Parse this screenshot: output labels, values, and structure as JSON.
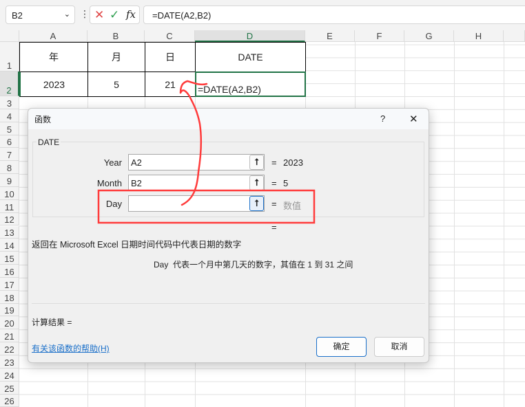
{
  "namebox": {
    "value": "B2"
  },
  "formula_bar": {
    "cancel_icon": "x-icon",
    "enter_icon": "check-icon",
    "fx": "fx",
    "formula": "=DATE(A2,B2)"
  },
  "columns": [
    "A",
    "B",
    "C",
    "D",
    "E",
    "F",
    "G",
    "H"
  ],
  "rows": [
    "1",
    "2",
    "3",
    "4",
    "5",
    "6",
    "7",
    "8",
    "9",
    "10",
    "11",
    "12",
    "13",
    "14",
    "15",
    "16",
    "17",
    "18",
    "19",
    "20",
    "21",
    "22",
    "23",
    "24",
    "25",
    "26"
  ],
  "cells": {
    "A1": "年",
    "B1": "月",
    "C1": "日",
    "D1": "DATE",
    "A2": "2023",
    "B2": "5",
    "C2": "21",
    "D2": "=DATE(A2,B2)"
  },
  "dialog": {
    "title": "函数",
    "help": "?",
    "close": "✕",
    "function_name": "DATE",
    "args": [
      {
        "label": "Year",
        "value": "A2",
        "result": "2023"
      },
      {
        "label": "Month",
        "value": "B2",
        "result": "5"
      },
      {
        "label": "Day",
        "value": "",
        "result": "数值"
      }
    ],
    "eq": "=",
    "overall_eq": "=",
    "description": "返回在 Microsoft Excel 日期时间代码中代表日期的数字",
    "arg_description": "Day  代表一个月中第几天的数字，其值在 1 到 31 之间",
    "result_label": "计算结果 =",
    "help_link": "有关该函数的帮助(H)",
    "ok": "确定",
    "cancel": "取消"
  },
  "annotation_color": "#ff3b3b",
  "accent": "#217346"
}
